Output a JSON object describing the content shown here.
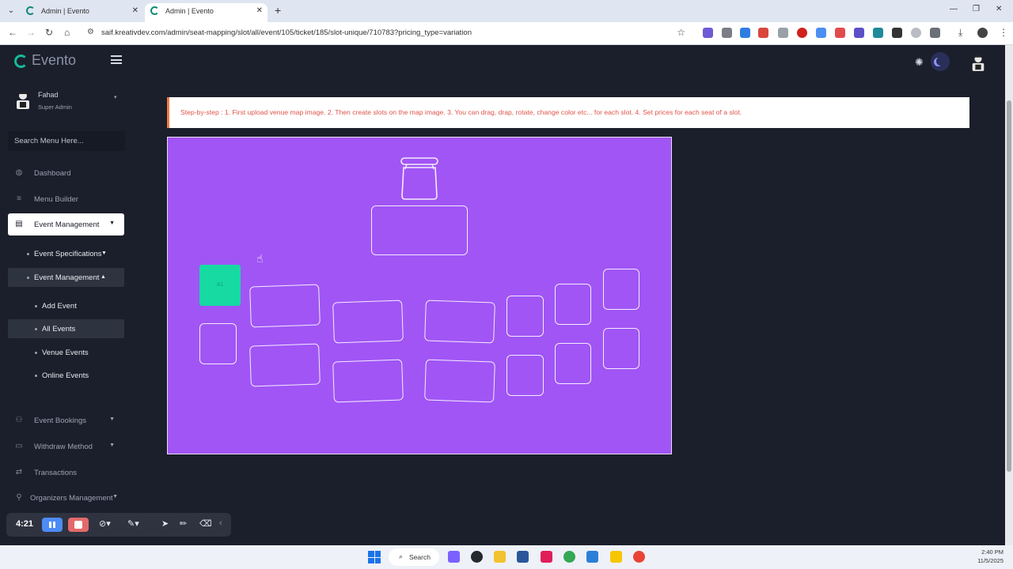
{
  "browser": {
    "tabs": [
      {
        "title": "Admin | Evento",
        "active": false
      },
      {
        "title": "Admin | Evento",
        "active": true
      }
    ],
    "url": "saif.kreativdev.com/admin/seat-mapping/slot/all/event/105/ticket/185/slot-unique/710783?pricing_type=variation"
  },
  "app": {
    "logo_text": "Evento",
    "user": {
      "name": "Fahad",
      "role": "Super Admin"
    },
    "search_placeholder": "Search Menu Here..."
  },
  "sidebar": {
    "items": [
      {
        "label": "Dashboard",
        "icon": "palette-icon"
      },
      {
        "label": "Menu Builder",
        "icon": "list-icon"
      },
      {
        "label": "Event Management",
        "icon": "book-icon",
        "active": true
      },
      {
        "label": "Event Bookings",
        "icon": "bookings-icon"
      },
      {
        "label": "Withdraw Method",
        "icon": "card-icon"
      },
      {
        "label": "Transactions",
        "icon": "exchange-icon"
      },
      {
        "label": "Organizers Management",
        "icon": "users-icon"
      }
    ],
    "submenu": {
      "event_specifications": "Event Specifications",
      "event_management": "Event Management",
      "children": [
        "Add Event",
        "All Events",
        "Venue Events",
        "Online Events"
      ]
    }
  },
  "notice": {
    "text": "Step-by-step : 1. First upload venue map image. 2. Then create slots on the map image. 3. You can drag, drap, rotate, change color etc... for each slot. 4. Set prices for each seat of a slot."
  },
  "map": {
    "background_color": "#a155f5",
    "selected_slot": {
      "label": "A1",
      "color": "#17d9a2"
    }
  },
  "recorder": {
    "time": "4:21"
  },
  "taskbar": {
    "search_label": "Search",
    "time": "2:40 PM",
    "date": "11/5/2025"
  }
}
